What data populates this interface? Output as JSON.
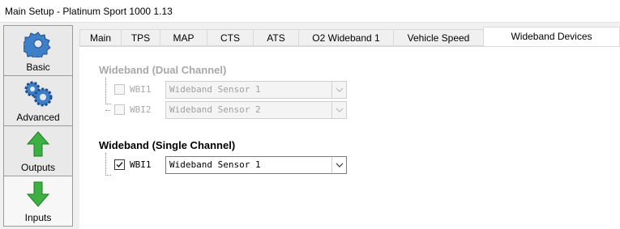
{
  "window": {
    "title": "Main Setup - Platinum Sport 1000 1.13"
  },
  "nav": [
    {
      "label": "Basic",
      "icon": "gear-icon"
    },
    {
      "label": "Advanced",
      "icon": "gears-icon"
    },
    {
      "label": "Outputs",
      "icon": "arrow-up-icon"
    },
    {
      "label": "Inputs",
      "icon": "arrow-down-icon"
    }
  ],
  "tabs": [
    {
      "label": "Main"
    },
    {
      "label": "TPS"
    },
    {
      "label": "MAP"
    },
    {
      "label": "CTS"
    },
    {
      "label": "ATS"
    },
    {
      "label": "O2 Wideband 1"
    },
    {
      "label": "Vehicle Speed"
    },
    {
      "label": "Wideband Devices",
      "active": true
    }
  ],
  "dual_channel": {
    "title": "Wideband (Dual Channel)",
    "enabled": false,
    "rows": [
      {
        "label": "WBI1",
        "checked": false,
        "value": "Wideband Sensor 1"
      },
      {
        "label": "WBI2",
        "checked": false,
        "value": "Wideband Sensor 2"
      }
    ]
  },
  "single_channel": {
    "title": "Wideband (Single Channel)",
    "enabled": true,
    "rows": [
      {
        "label": "WBI1",
        "checked": true,
        "value": "Wideband Sensor 1"
      }
    ]
  },
  "colors": {
    "disabled_text": "#a8a8a8",
    "nav_green": "#3cb043",
    "gear_blue": "#3f7fc8"
  }
}
